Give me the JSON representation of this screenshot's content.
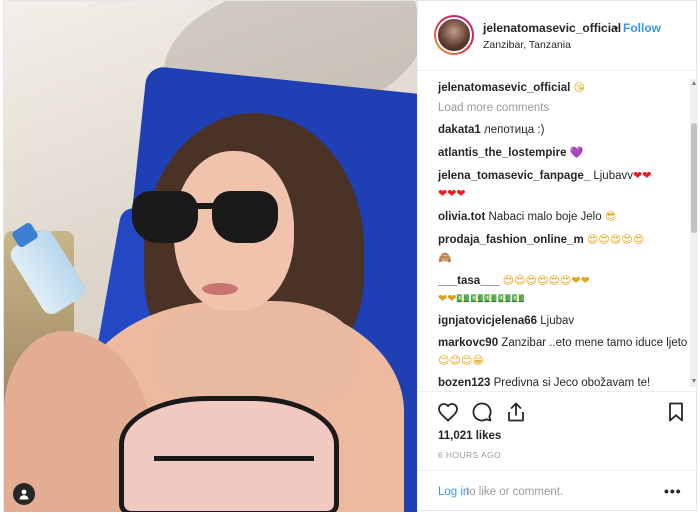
{
  "header": {
    "username": "jelenatomasevic_official",
    "separator": "•",
    "follow_label": "Follow",
    "location": "Zanzibar, Tanzania"
  },
  "caption": {
    "username": "jelenatomasevic_official",
    "emoji": "😘"
  },
  "load_more_label": "Load more comments",
  "comments": [
    {
      "username": "dakata1",
      "text": "лепотица :)"
    },
    {
      "username": "atlantis_the_lostempire",
      "text": "",
      "emoji": "💜"
    },
    {
      "username": "jelena_tomasevic_fanpage_",
      "text": "Ljubavv",
      "emoji": "❤❤",
      "emoji2": "❤❤❤"
    },
    {
      "username": "olivia.tot",
      "text": "Nabaci malo boje Jelo",
      "emoji": "😎"
    },
    {
      "username": "prodaja_fashion_online_m",
      "text": "",
      "emoji": "😍😍😍😍😍",
      "emoji2": "🙈"
    },
    {
      "username": "___tasa___",
      "text": "",
      "emoji": "😍😍😍😍😍😍❤❤",
      "emoji2": "❤❤💵💵💵💵💵"
    },
    {
      "username": "ignjatovicjelena66",
      "text": "Ljubav"
    },
    {
      "username": "markovc90",
      "text": "Zanzibar ..eto mene tamo iduce ljeto",
      "emoji": "😊😊😊😁"
    },
    {
      "username": "bozen123",
      "text": "Predivna si Jeco obožavam te! Najbolja i najlepša.Može li follow molim te ispuni mi želju biće mi velika čast ako"
    }
  ],
  "actions": {
    "likes": "11,021 likes",
    "timestamp": "6 HOURS AGO",
    "login_link": "Log in",
    "login_rest": "to like or comment.",
    "more": "•••"
  },
  "colors": {
    "accent": "#3897f0",
    "muted": "#999999",
    "text": "#262626",
    "border": "#efefef"
  },
  "icons": {
    "like": "heart-icon",
    "comment": "comment-bubble-icon",
    "share": "share-icon",
    "save": "bookmark-icon",
    "tag": "person-tag-icon"
  }
}
